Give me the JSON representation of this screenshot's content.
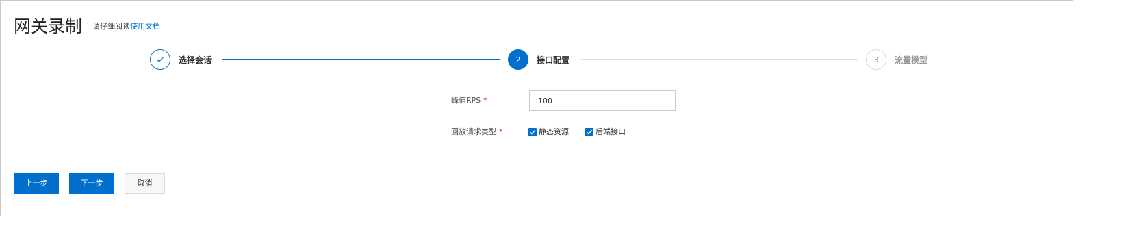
{
  "header": {
    "title": "网关录制",
    "hint_prefix": "请仔细阅读",
    "doc_link": "使用文档"
  },
  "steps": [
    {
      "label": "选择会话",
      "status": "done",
      "icon": "check-icon"
    },
    {
      "label": "接口配置",
      "status": "current",
      "number": "2"
    },
    {
      "label": "流量模型",
      "status": "pending",
      "number": "3"
    }
  ],
  "form": {
    "rps": {
      "label": "峰值RPS",
      "required_mark": "*",
      "value": "100"
    },
    "replay_type": {
      "label": "回放请求类型",
      "required_mark": "*",
      "options": [
        {
          "label": "静态资源",
          "checked": true
        },
        {
          "label": "后端接口",
          "checked": true
        }
      ]
    }
  },
  "actions": {
    "prev": "上一步",
    "next": "下一步",
    "cancel": "取消"
  },
  "colors": {
    "accent": "#0070cc",
    "required": "#d93026",
    "inactive": "#999999"
  }
}
